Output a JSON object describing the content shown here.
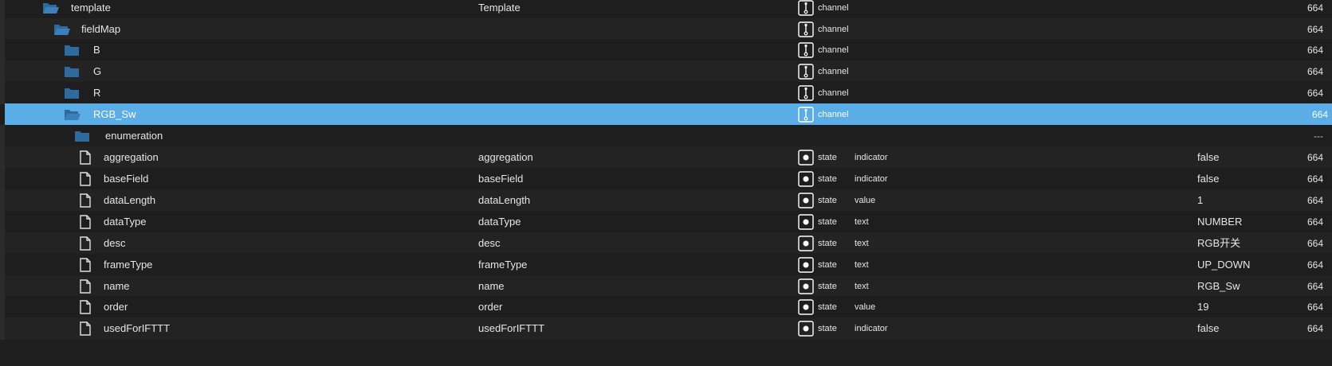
{
  "colors": {
    "background": "#1e1e1e",
    "selected_row": "#5aade6",
    "folder_icon": "#2f6a9e",
    "text": "#e6e6e6"
  },
  "rows": [
    {
      "kind": "folder-open",
      "name": "template",
      "title": "Template",
      "role_icon": "channel-icon",
      "type": "channel",
      "role": "",
      "value": "",
      "num": "664"
    },
    {
      "kind": "folder-open",
      "name": "fieldMap",
      "title": "",
      "role_icon": "channel-icon",
      "type": "channel",
      "role": "",
      "value": "",
      "num": "664"
    },
    {
      "kind": "folder",
      "name": "B",
      "title": "",
      "role_icon": "channel-icon",
      "type": "channel",
      "role": "",
      "value": "",
      "num": "664"
    },
    {
      "kind": "folder",
      "name": "G",
      "title": "",
      "role_icon": "channel-icon",
      "type": "channel",
      "role": "",
      "value": "",
      "num": "664"
    },
    {
      "kind": "folder",
      "name": "R",
      "title": "",
      "role_icon": "channel-icon",
      "type": "channel",
      "role": "",
      "value": "",
      "num": "664"
    },
    {
      "kind": "folder-open",
      "name": "RGB_Sw",
      "title": "",
      "role_icon": "channel-icon",
      "type": "channel",
      "role": "",
      "value": "",
      "num": "664",
      "selected": true
    },
    {
      "kind": "folder",
      "name": "enumeration",
      "title": "",
      "role_icon": "",
      "type": "",
      "role": "",
      "value": "",
      "num": "---"
    },
    {
      "kind": "file",
      "name": "aggregation",
      "title": "aggregation",
      "role_icon": "state-icon",
      "type": "state",
      "role": "indicator",
      "value": "false",
      "num": "664"
    },
    {
      "kind": "file",
      "name": "baseField",
      "title": "baseField",
      "role_icon": "state-icon",
      "type": "state",
      "role": "indicator",
      "value": "false",
      "num": "664"
    },
    {
      "kind": "file",
      "name": "dataLength",
      "title": "dataLength",
      "role_icon": "state-icon",
      "type": "state",
      "role": "value",
      "value": "1",
      "num": "664"
    },
    {
      "kind": "file",
      "name": "dataType",
      "title": "dataType",
      "role_icon": "state-icon",
      "type": "state",
      "role": "text",
      "value": "NUMBER",
      "num": "664"
    },
    {
      "kind": "file",
      "name": "desc",
      "title": "desc",
      "role_icon": "state-icon",
      "type": "state",
      "role": "text",
      "value": "RGB开关",
      "num": "664"
    },
    {
      "kind": "file",
      "name": "frameType",
      "title": "frameType",
      "role_icon": "state-icon",
      "type": "state",
      "role": "text",
      "value": "UP_DOWN",
      "num": "664"
    },
    {
      "kind": "file",
      "name": "name",
      "title": "name",
      "role_icon": "state-icon",
      "type": "state",
      "role": "text",
      "value": "RGB_Sw",
      "num": "664"
    },
    {
      "kind": "file",
      "name": "order",
      "title": "order",
      "role_icon": "state-icon",
      "type": "state",
      "role": "value",
      "value": "19",
      "num": "664"
    },
    {
      "kind": "file",
      "name": "usedForIFTTT",
      "title": "usedForIFTTT",
      "role_icon": "state-icon",
      "type": "state",
      "role": "indicator",
      "value": "false",
      "num": "664"
    }
  ]
}
